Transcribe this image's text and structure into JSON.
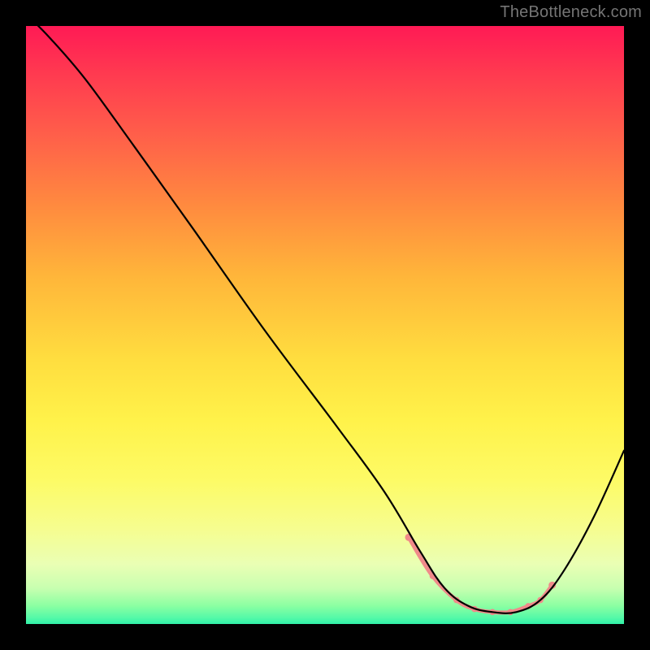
{
  "watermark": "TheBottleneck.com",
  "chart_data": {
    "type": "line",
    "title": "",
    "xlabel": "",
    "ylabel": "",
    "xlim": [
      0,
      100
    ],
    "ylim": [
      0,
      100
    ],
    "grid": false,
    "legend": false,
    "description": "Bottleneck curve on red-to-green vertical gradient; minimum (green zone) around x≈70–85",
    "series": [
      {
        "name": "bottleneck-curve",
        "x": [
          0,
          4,
          10,
          18,
          28,
          40,
          52,
          60,
          66,
          70,
          74,
          78,
          82,
          86,
          90,
          95,
          100
        ],
        "y": [
          102,
          98,
          91,
          80,
          66,
          49,
          33,
          22,
          12,
          6,
          3,
          2,
          2,
          4,
          9,
          18,
          29
        ]
      }
    ],
    "highlight_range": {
      "name": "optimal-zone",
      "x": [
        64,
        68,
        72,
        75,
        78,
        81,
        84,
        86,
        88
      ],
      "y": [
        14.5,
        8,
        4,
        2.5,
        2,
        2,
        3,
        4,
        6.5
      ]
    },
    "gradient_stops": [
      {
        "pos": 0.0,
        "color": "#ff1a55"
      },
      {
        "pos": 0.3,
        "color": "#ff8a3f"
      },
      {
        "pos": 0.6,
        "color": "#fff24a"
      },
      {
        "pos": 0.9,
        "color": "#eaffb4"
      },
      {
        "pos": 1.0,
        "color": "#31f2a8"
      }
    ]
  }
}
